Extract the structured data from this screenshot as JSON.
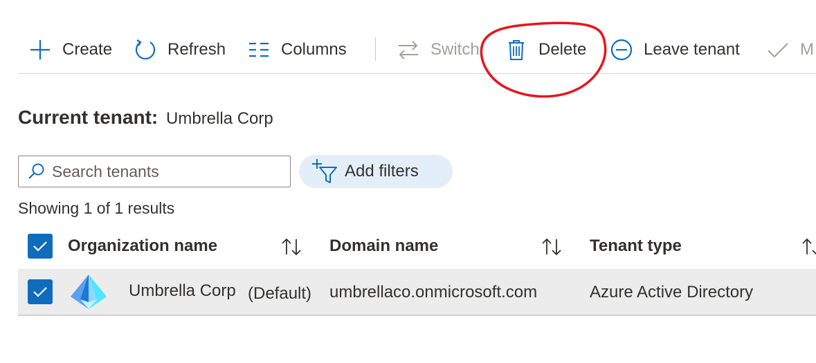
{
  "toolbar": {
    "create_label": "Create",
    "refresh_label": "Refresh",
    "columns_label": "Columns",
    "switch_label": "Switch",
    "delete_label": "Delete",
    "leave_label": "Leave tenant",
    "manage_label": "M"
  },
  "current_tenant": {
    "label": "Current tenant:",
    "value": "Umbrella Corp"
  },
  "search": {
    "placeholder": "Search tenants"
  },
  "filters": {
    "label": "Add filters"
  },
  "results_text": "Showing 1 of 1 results",
  "table": {
    "columns": [
      "Organization name",
      "Domain name",
      "Tenant type"
    ],
    "rows": [
      {
        "name": "Umbrella Corp",
        "badge": "(Default)",
        "domain": "umbrellaco.onmicrosoft.com",
        "type": "Azure Active Directory",
        "selected": true
      }
    ]
  },
  "colors": {
    "accent": "#0f6cbd",
    "annotation": "#e8141e",
    "row_selected": "#ececec",
    "filter_pill": "#e4eef9"
  }
}
